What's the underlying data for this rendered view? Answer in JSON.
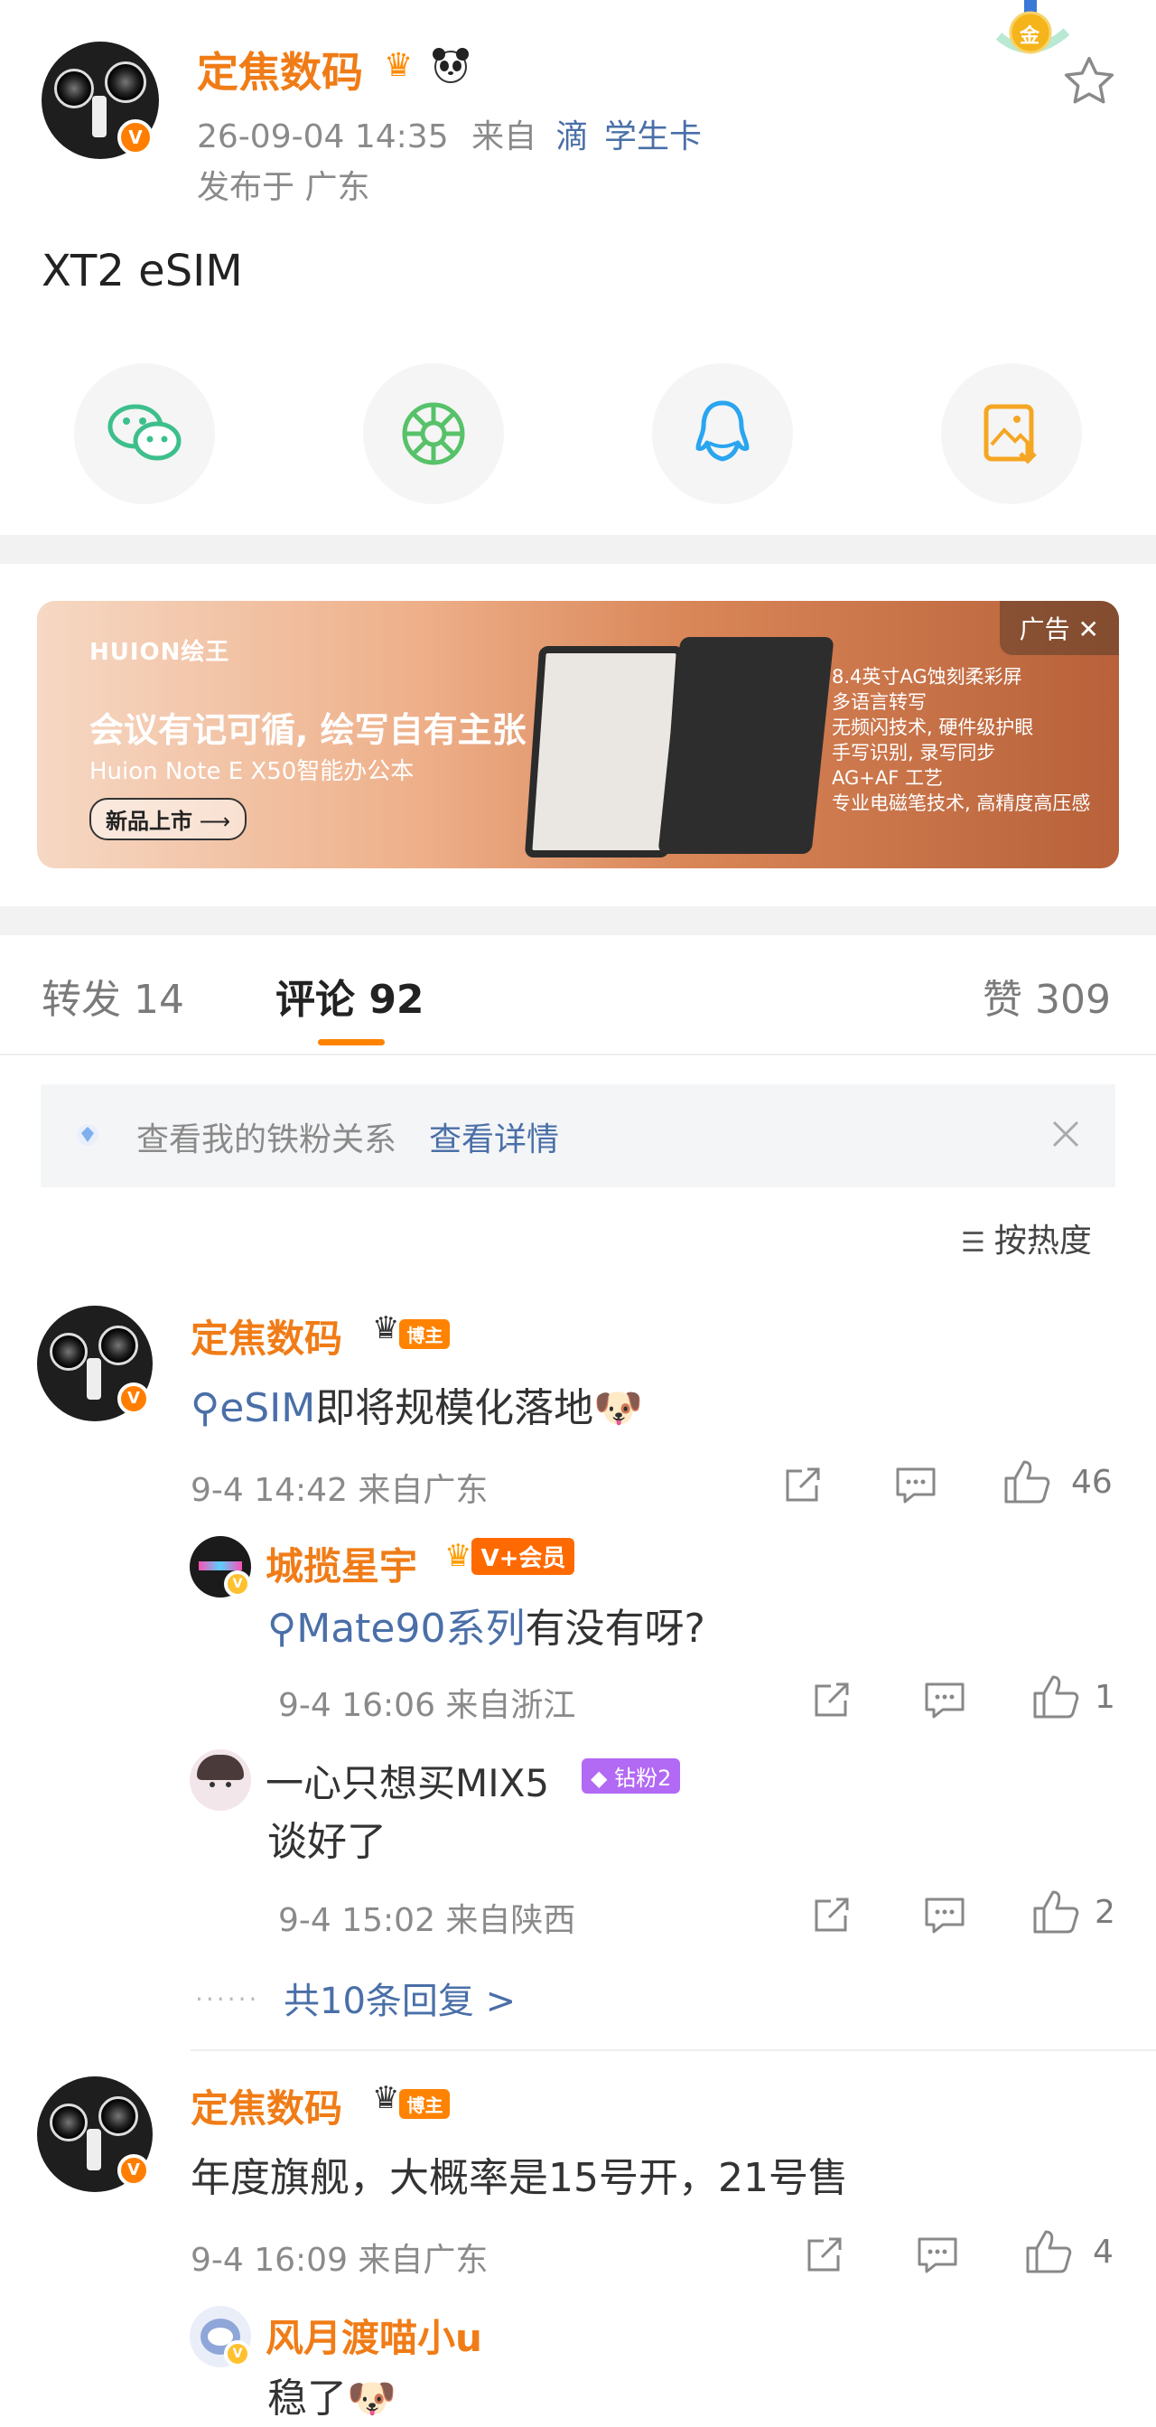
{
  "post": {
    "author": "定焦数码",
    "time": "26-09-04 14:35",
    "from_label": "来自",
    "source_badge": "滴",
    "source": "学生卡",
    "location": "发布于 广东",
    "content": "XT2 eSIM",
    "medal_text": "金"
  },
  "share": [
    {
      "name": "wechat",
      "icon": "wechat-icon"
    },
    {
      "name": "moments",
      "icon": "moments-icon"
    },
    {
      "name": "qq",
      "icon": "qq-icon"
    },
    {
      "name": "save-image",
      "icon": "save-image-icon"
    }
  ],
  "ad": {
    "tag": "广告",
    "brand": "HUION绘王",
    "slogan": "会议有记可循, 绘写自有主张",
    "subtitle": "Huion Note E X50智能办公本",
    "button": "新品上市",
    "features": [
      "8.4英寸AG蚀刻柔彩屏",
      "多语言转写",
      "无频闪技术, 硬件级护眼",
      "手写识别, 录写同步",
      "AG+AF 工艺",
      "专业电磁笔技术, 高精度高压感"
    ]
  },
  "tabs": {
    "repost": "转发 14",
    "comments": "评论 92",
    "likes": "赞 309"
  },
  "fan": {
    "text": "查看我的铁粉关系",
    "link": "查看详情"
  },
  "sort": {
    "label": "按热度"
  },
  "comments": [
    {
      "author": "定焦数码",
      "badge": "博主",
      "topic": "eSIM",
      "text": "即将规模化落地",
      "emoji": "🐶",
      "time": "9-4 14:42 来自广东",
      "likes": "46",
      "replies": [
        {
          "author": "城揽星宇",
          "badge": "V+会员",
          "topic": "Mate90系列",
          "text": "有没有呀?",
          "time": "9-4 16:06 来自浙江",
          "likes": "1"
        },
        {
          "author": "一心只想买MIX5",
          "badge": "钻粉2",
          "text": "谈好了",
          "time": "9-4 15:02 来自陕西",
          "likes": "2"
        }
      ],
      "more_replies": "共10条回复 >"
    },
    {
      "author": "定焦数码",
      "badge": "博主",
      "text": "年度旗舰，大概率是15号开，21号售",
      "time": "9-4 16:09 来自广东",
      "likes": "4",
      "replies": [
        {
          "author": "风月渡喵小u",
          "text": "稳了",
          "emoji": "🐶"
        }
      ]
    }
  ]
}
